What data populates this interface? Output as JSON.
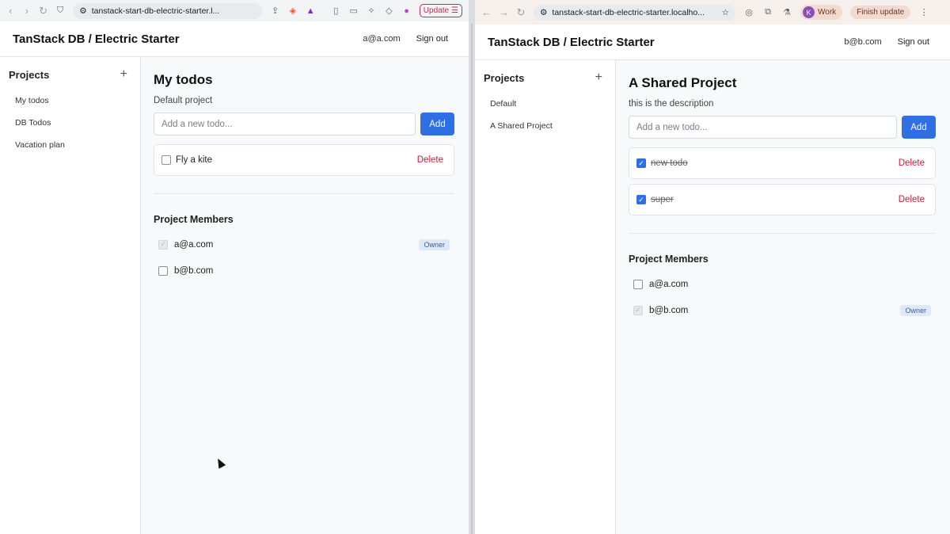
{
  "left": {
    "browser": {
      "url": "tanstack-start-db-electric-starter.l...",
      "update_label": "Update"
    },
    "app": {
      "title": "TanStack DB / Electric Starter",
      "user_email": "a@a.com",
      "sign_out": "Sign out"
    },
    "sidebar": {
      "title": "Projects",
      "add": "+",
      "items": [
        {
          "label": "My todos"
        },
        {
          "label": "DB Todos"
        },
        {
          "label": "Vacation plan"
        }
      ]
    },
    "main": {
      "title": "My todos",
      "description": "Default project",
      "input_placeholder": "Add a new todo...",
      "add_label": "Add",
      "todos": [
        {
          "text": "Fly a kite",
          "checked": false,
          "delete_label": "Delete"
        }
      ],
      "members_title": "Project Members",
      "members": [
        {
          "email": "a@a.com",
          "badge": "Owner",
          "checked": true
        },
        {
          "email": "b@b.com",
          "badge": "",
          "checked": false
        }
      ]
    }
  },
  "right": {
    "browser": {
      "url": "tanstack-start-db-electric-starter.localho...",
      "profile_initial": "K",
      "profile_label": "Work",
      "finish_label": "Finish update"
    },
    "app": {
      "title": "TanStack DB / Electric Starter",
      "user_email": "b@b.com",
      "sign_out": "Sign out"
    },
    "sidebar": {
      "title": "Projects",
      "add": "+",
      "items": [
        {
          "label": "Default"
        },
        {
          "label": "A Shared Project"
        }
      ]
    },
    "main": {
      "title": "A Shared Project",
      "description": "this is the description",
      "input_placeholder": "Add a new todo...",
      "add_label": "Add",
      "todos": [
        {
          "text": "new todo",
          "checked": true,
          "delete_label": "Delete"
        },
        {
          "text": "super",
          "checked": true,
          "delete_label": "Delete"
        }
      ],
      "members_title": "Project Members",
      "members": [
        {
          "email": "a@a.com",
          "badge": "",
          "checked": false
        },
        {
          "email": "b@b.com",
          "badge": "Owner",
          "checked": true
        }
      ]
    }
  },
  "colors": {
    "accent": "#2f6fe4",
    "danger": "#d0183e",
    "owner_badge_bg": "#dde9f8"
  }
}
